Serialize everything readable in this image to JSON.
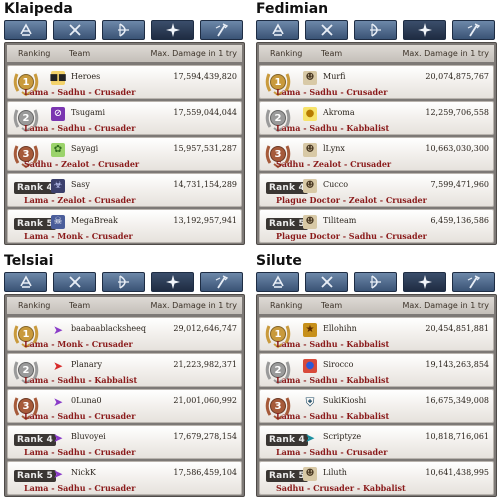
{
  "header": {
    "ranking": "Ranking",
    "team": "Team",
    "damage": "Max. Damage in 1 try"
  },
  "colors": {
    "gold": "#c99a3c",
    "silver": "#9a9a9a",
    "bronze": "#a65a3a",
    "job_text": "#8a1a1a"
  },
  "tabs": [
    {
      "icon": "helmet-icon"
    },
    {
      "icon": "crossed-swords-icon"
    },
    {
      "icon": "bow-icon"
    },
    {
      "icon": "cross-star-icon"
    },
    {
      "icon": "staff-icon"
    }
  ],
  "servers": [
    {
      "name": "Klaipeda",
      "active_tab": 3,
      "rows": [
        {
          "rank": "1",
          "name": "Heroes",
          "damage": "17,594,439,820",
          "jobs": "Lama - Sadhu - Crusader",
          "avatar": "sunglasses-face-icon"
        },
        {
          "rank": "2",
          "name": "Tsugami",
          "damage": "17,559,044,044",
          "jobs": "Lama - Sadhu - Crusader",
          "avatar": "purple-no-sign-icon"
        },
        {
          "rank": "3",
          "name": "Sayagi",
          "damage": "15,957,531,287",
          "jobs": "Sadhu - Zealot - Crusader",
          "avatar": "green-creature-icon"
        },
        {
          "rank": "Rank 4",
          "name": "Sasy",
          "damage": "14,731,154,289",
          "jobs": "Lama - Zealot - Crusader",
          "avatar": "dark-monster-icon"
        },
        {
          "rank": "Rank 5",
          "name": "MegaBreak",
          "damage": "13,192,957,941",
          "jobs": "Lama - Monk - Crusader",
          "avatar": "skull-icon"
        }
      ]
    },
    {
      "name": "Fedimian",
      "active_tab": 3,
      "rows": [
        {
          "rank": "1",
          "name": "Murfi",
          "damage": "20,074,875,767",
          "jobs": "Lama - Sadhu - Crusader",
          "avatar": "character-portrait-icon"
        },
        {
          "rank": "2",
          "name": "Akroma",
          "damage": "12,259,706,558",
          "jobs": "Lama - Sadhu - Kabbalist",
          "avatar": "yellow-chick-icon"
        },
        {
          "rank": "3",
          "name": "lLynx",
          "damage": "10,663,030,300",
          "jobs": "Sadhu - Zealot - Crusader",
          "avatar": "character-portrait-icon"
        },
        {
          "rank": "Rank 4",
          "name": "Cucco",
          "damage": "7,599,471,960",
          "jobs": "Plague Doctor - Zealot - Crusader",
          "avatar": "character-portrait-icon"
        },
        {
          "rank": "Rank 5",
          "name": "Tiliteam",
          "damage": "6,459,136,586",
          "jobs": "Plague Doctor - Sadhu - Crusader",
          "avatar": "character-portrait-icon"
        }
      ]
    },
    {
      "name": "Telsiai",
      "active_tab": 3,
      "rows": [
        {
          "rank": "1",
          "name": "baabaablacksheeq",
          "damage": "29,012,646,747",
          "jobs": "Lama - Monk - Crusader",
          "avatar": "purple-runner-icon"
        },
        {
          "rank": "2",
          "name": "Planary",
          "damage": "21,223,982,371",
          "jobs": "Lama - Sadhu - Kabbalist",
          "avatar": "red-bird-icon"
        },
        {
          "rank": "3",
          "name": "0Luna0",
          "damage": "21,001,060,992",
          "jobs": "Lama - Sadhu - Crusader",
          "avatar": "purple-runner-icon"
        },
        {
          "rank": "Rank 4",
          "name": "Bluvoyei",
          "damage": "17,679,278,154",
          "jobs": "Lama - Sadhu - Crusader",
          "avatar": "purple-runner-icon"
        },
        {
          "rank": "Rank 5",
          "name": "NickK",
          "damage": "17,586,459,104",
          "jobs": "Lama - Sadhu - Crusader",
          "avatar": "purple-runner-icon"
        }
      ]
    },
    {
      "name": "Silute",
      "active_tab": 3,
      "rows": [
        {
          "rank": "1",
          "name": "Ellohihn",
          "damage": "20,454,851,881",
          "jobs": "Lama - Sadhu - Kabbalist",
          "avatar": "gold-emblem-icon"
        },
        {
          "rank": "2",
          "name": "Sirocco",
          "damage": "19,143,263,854",
          "jobs": "Lama - Sadhu - Kabbalist",
          "avatar": "blue-orb-icon"
        },
        {
          "rank": "3",
          "name": "SukiKioshi",
          "damage": "16,675,349,008",
          "jobs": "Lama - Sadhu - Kabbalist",
          "avatar": "dark-shield-icon"
        },
        {
          "rank": "Rank 4",
          "name": "Scriptyze",
          "damage": "10,818,716,061",
          "jobs": "Lama - Sadhu - Crusader",
          "avatar": "teal-bird-icon"
        },
        {
          "rank": "Rank 5",
          "name": "Liluth",
          "damage": "10,641,438,995",
          "jobs": "Sadhu - Crusader - Kabbalist",
          "avatar": "character-portrait-icon"
        }
      ]
    }
  ]
}
